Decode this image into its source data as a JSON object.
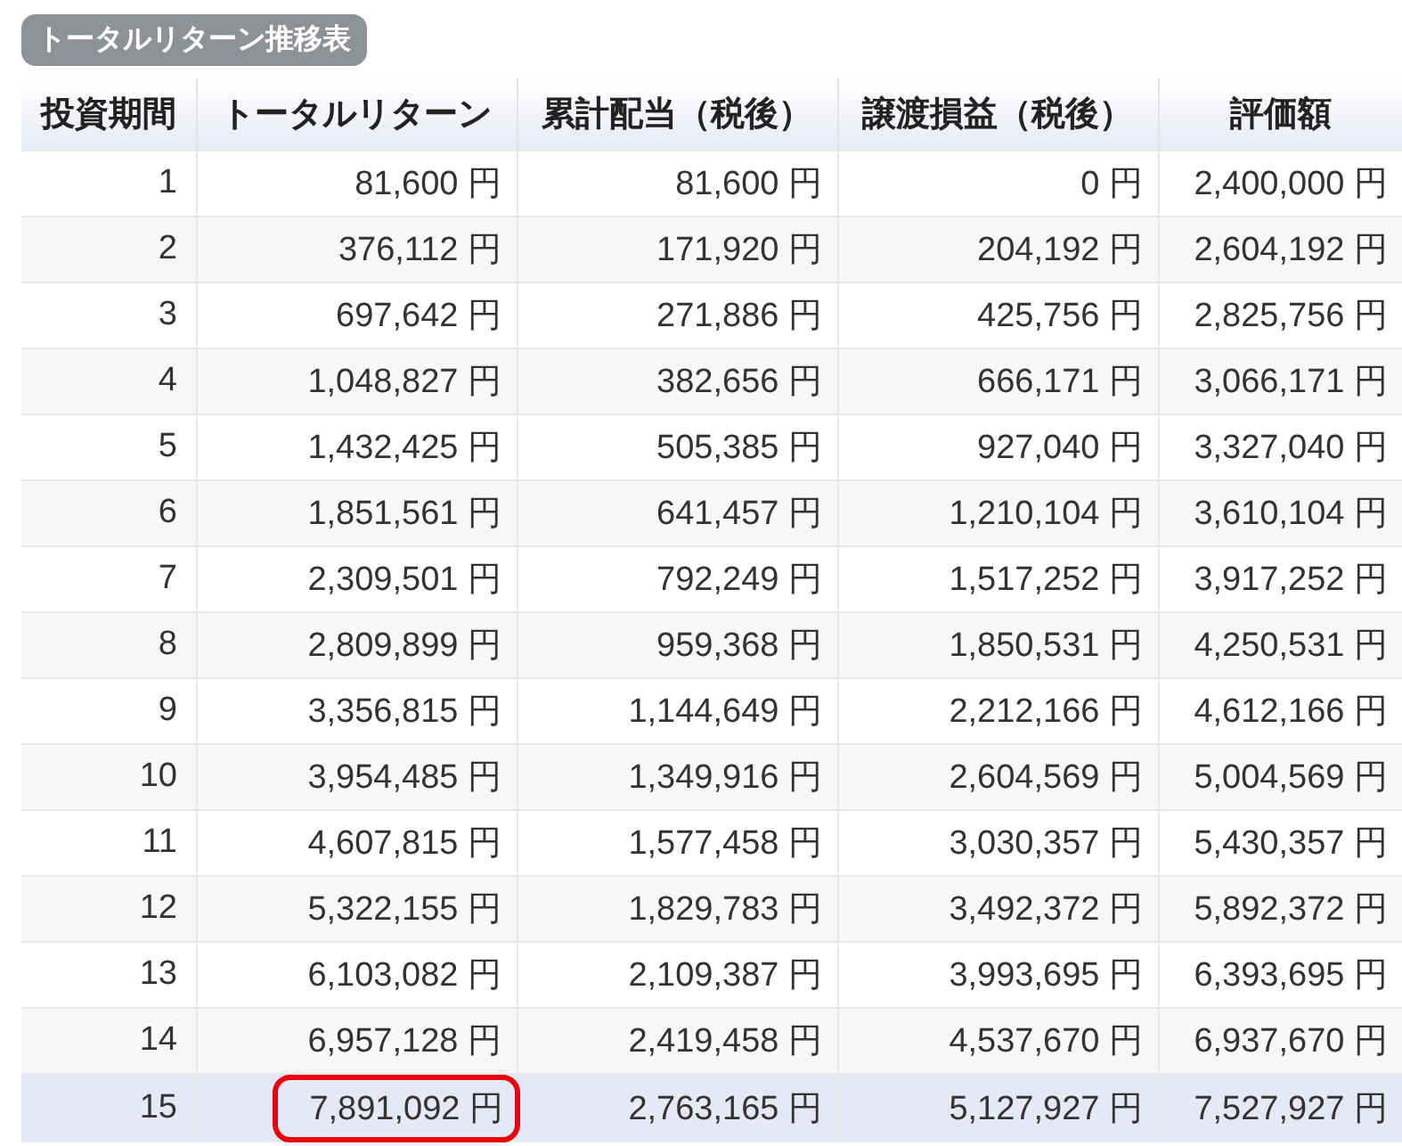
{
  "title": "トータルリターン推移表",
  "table": {
    "columns": [
      "投資期間",
      "トータルリターン",
      "累計配当（税後）",
      "譲渡損益（税後）",
      "評価額"
    ],
    "rows": [
      {
        "cells": [
          "1",
          "81,600 円",
          "81,600 円",
          "0 円",
          "2,400,000 円"
        ],
        "selected": false,
        "circled": false
      },
      {
        "cells": [
          "2",
          "376,112 円",
          "171,920 円",
          "204,192 円",
          "2,604,192 円"
        ],
        "selected": false,
        "circled": false
      },
      {
        "cells": [
          "3",
          "697,642 円",
          "271,886 円",
          "425,756 円",
          "2,825,756 円"
        ],
        "selected": false,
        "circled": false
      },
      {
        "cells": [
          "4",
          "1,048,827 円",
          "382,656 円",
          "666,171 円",
          "3,066,171 円"
        ],
        "selected": false,
        "circled": false
      },
      {
        "cells": [
          "5",
          "1,432,425 円",
          "505,385 円",
          "927,040 円",
          "3,327,040 円"
        ],
        "selected": false,
        "circled": false
      },
      {
        "cells": [
          "6",
          "1,851,561 円",
          "641,457 円",
          "1,210,104 円",
          "3,610,104 円"
        ],
        "selected": false,
        "circled": false
      },
      {
        "cells": [
          "7",
          "2,309,501 円",
          "792,249 円",
          "1,517,252 円",
          "3,917,252 円"
        ],
        "selected": false,
        "circled": false
      },
      {
        "cells": [
          "8",
          "2,809,899 円",
          "959,368 円",
          "1,850,531 円",
          "4,250,531 円"
        ],
        "selected": false,
        "circled": false
      },
      {
        "cells": [
          "9",
          "3,356,815 円",
          "1,144,649 円",
          "2,212,166 円",
          "4,612,166 円"
        ],
        "selected": false,
        "circled": false
      },
      {
        "cells": [
          "10",
          "3,954,485 円",
          "1,349,916 円",
          "2,604,569 円",
          "5,004,569 円"
        ],
        "selected": false,
        "circled": false
      },
      {
        "cells": [
          "11",
          "4,607,815 円",
          "1,577,458 円",
          "3,030,357 円",
          "5,430,357 円"
        ],
        "selected": false,
        "circled": false
      },
      {
        "cells": [
          "12",
          "5,322,155 円",
          "1,829,783 円",
          "3,492,372 円",
          "5,892,372 円"
        ],
        "selected": false,
        "circled": false
      },
      {
        "cells": [
          "13",
          "6,103,082 円",
          "2,109,387 円",
          "3,993,695 円",
          "6,393,695 円"
        ],
        "selected": false,
        "circled": false
      },
      {
        "cells": [
          "14",
          "6,957,128 円",
          "2,419,458 円",
          "4,537,670 円",
          "6,937,670 円"
        ],
        "selected": false,
        "circled": false
      },
      {
        "cells": [
          "15",
          "7,891,092 円",
          "2,763,165 円",
          "5,127,927 円",
          "7,527,927 円"
        ],
        "selected": true,
        "circled": true
      }
    ]
  }
}
